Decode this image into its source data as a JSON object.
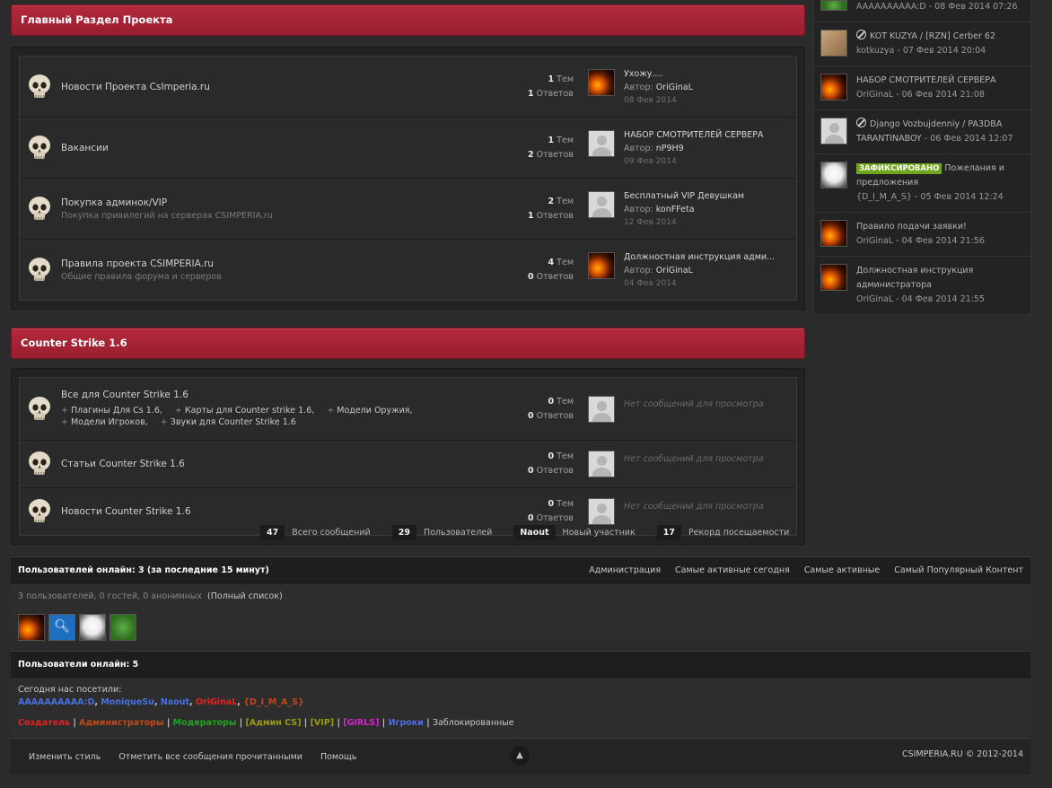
{
  "categories": [
    {
      "title": "Главный Раздел Проекта",
      "forums": [
        {
          "name": "Новости Проекта CsImperia.ru",
          "desc": "",
          "topics": "1",
          "topics_label": "Тем",
          "replies": "1",
          "replies_label": "Ответов",
          "last_title": "Ухожу....",
          "last_author_label": "Автор:",
          "last_author": "OriGinaL",
          "last_date": "08 Фев 2014",
          "avatar": "fire"
        },
        {
          "name": "Вакансии",
          "desc": "",
          "topics": "1",
          "topics_label": "Тем",
          "replies": "2",
          "replies_label": "Ответов",
          "last_title": "НАБОР СМОТРИТЕЛЕЙ СЕРВЕРА",
          "last_author_label": "Автор:",
          "last_author": "nP9H9",
          "last_date": "09 Фев 2014",
          "avatar": "blank"
        },
        {
          "name": "Покупка админок/VIP",
          "desc": "Покупка привилегий на серверах CSIMPERIA.ru",
          "topics": "2",
          "topics_label": "Тем",
          "replies": "1",
          "replies_label": "Ответов",
          "last_title": "Бесплатный VIP Девушкам",
          "last_author_label": "Автор:",
          "last_author": "konFFeta",
          "last_date": "12 Фев 2014",
          "avatar": "blank"
        },
        {
          "name": "Правила проекта CSIMPERIA.ru",
          "desc": "Общие правила форума и серверов",
          "topics": "4",
          "topics_label": "Тем",
          "replies": "0",
          "replies_label": "Ответов",
          "last_title": "Должностная инструкция адми...",
          "last_author_label": "Автор:",
          "last_author": "OriGinaL",
          "last_date": "04 Фев 2014",
          "avatar": "fire"
        }
      ]
    },
    {
      "title": "Counter Strike 1.6",
      "forums": [
        {
          "name": "Все для Counter Strike 1.6",
          "desc": "",
          "subforums": [
            "Плагины Для Cs 1.6,",
            "Карты для Counter strike 1.6,",
            "Модели Оружия,",
            "Модели Игроков,",
            "Звуки для Counter Strike 1.6"
          ],
          "topics": "0",
          "topics_label": "Тем",
          "replies": "0",
          "replies_label": "Ответов",
          "no_posts": "Нет сообщений для просмотра",
          "avatar": "blank"
        },
        {
          "name": "Статьи Counter Strike 1.6",
          "desc": "",
          "topics": "0",
          "topics_label": "Тем",
          "replies": "0",
          "replies_label": "Ответов",
          "no_posts": "Нет сообщений для просмотра",
          "avatar": "blank"
        },
        {
          "name": "Новости Counter Strike 1.6",
          "desc": "",
          "topics": "0",
          "topics_label": "Тем",
          "replies": "0",
          "replies_label": "Ответов",
          "no_posts": "Нет сообщений для просмотра",
          "avatar": "blank"
        }
      ]
    }
  ],
  "board_stats": [
    {
      "value": "47",
      "label": "Всего сообщений"
    },
    {
      "value": "29",
      "label": "Пользователей"
    },
    {
      "value": "Naout",
      "label": "Новый участник"
    },
    {
      "value": "17",
      "label": "Рекорд посещаемости"
    }
  ],
  "online": {
    "title": "Пользователей онлайн: 3 (за последние 15 минут)",
    "links": [
      "Администрация",
      "Самые активные сегодня",
      "Самые активные",
      "Самый Популярный Контент"
    ],
    "summary": "3 пользователей, 0 гостей, 0 анонимных",
    "full_list": "(Полный список)",
    "avatars": [
      "fire",
      "search",
      "troll",
      "green"
    ],
    "users_online_title": "Пользователи онлайн: 5",
    "visited_label": "Сегодня нас посетили:",
    "visitors": [
      {
        "name": "AAAAAAAAAA:D",
        "color": "#4a6fe0"
      },
      {
        "name": "MoniqueSu",
        "color": "#4a6fe0"
      },
      {
        "name": "Naout",
        "color": "#4a6fe0"
      },
      {
        "name": "OriGinaL",
        "color": "#e82020"
      },
      {
        "name": "{D_I_M_A_S}",
        "color": "#c2471a"
      }
    ],
    "groups": [
      {
        "name": "Создатель",
        "color": "#e82020"
      },
      {
        "name": "Администраторы",
        "color": "#c2471a"
      },
      {
        "name": "Модераторы",
        "color": "#22a322"
      },
      {
        "name": "[Админ CS]",
        "color": "#9a9a12"
      },
      {
        "name": "[VIP]",
        "color": "#9a9a12"
      },
      {
        "name": "[GIRLS]",
        "color": "#d026d0"
      },
      {
        "name": "Игроки",
        "color": "#4a6fe0"
      },
      {
        "name": "Заблокированные",
        "color": "#c8c8c8"
      }
    ]
  },
  "footer": {
    "links": [
      "Изменить стиль",
      "Отметить все сообщения прочитанными",
      "Помощь"
    ],
    "up": "▲",
    "copyright": "CSIMPERIA.RU © 2012-2014"
  },
  "sidebar": [
    {
      "avatar": "green",
      "locked": false,
      "badge": "",
      "title": "",
      "meta": "AAAAAAAAAA:D - 08 Фев 2014 07:26"
    },
    {
      "avatar": "cat",
      "locked": true,
      "badge": "",
      "title": "KOT KUZYA / [RZN] Cerber 62",
      "meta": "kotkuzya - 07 Фев 2014 20:04"
    },
    {
      "avatar": "fire",
      "locked": false,
      "badge": "",
      "title": "НАБОР СМОТРИТЕЛЕЙ СЕРВЕРА",
      "meta": "OriGinaL - 06 Фев 2014 21:08"
    },
    {
      "avatar": "blank",
      "locked": true,
      "badge": "",
      "title": "Django Vozbujdenniy / PA3DBA TARANTINABOY",
      "meta": "- 06 Фев 2014 12:07"
    },
    {
      "avatar": "troll",
      "locked": false,
      "badge": "ЗАФИКСИРОВАНО",
      "title": "Пожелания и предложения",
      "meta": "{D_I_M_A_S} - 05 Фев 2014 12:24"
    },
    {
      "avatar": "fire",
      "locked": false,
      "badge": "",
      "title": "Правило подачи заявки!",
      "meta": "OriGinaL - 04 Фев 2014 21:56"
    },
    {
      "avatar": "fire",
      "locked": false,
      "badge": "",
      "title": "Должностная инструкция администратора",
      "meta": "OriGinaL - 04 Фев 2014 21:55"
    }
  ]
}
